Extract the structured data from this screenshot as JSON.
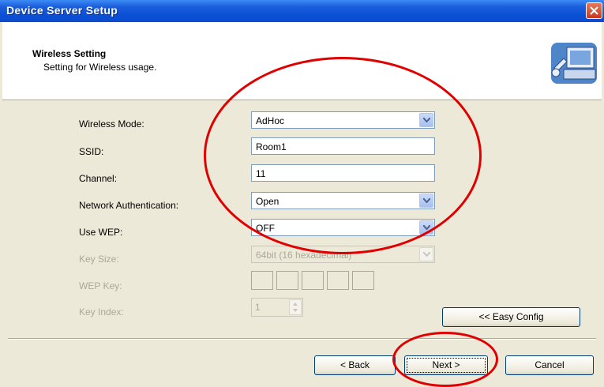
{
  "window": {
    "title": "Device Server Setup"
  },
  "header": {
    "title": "Wireless Setting",
    "subtitle": "Setting for Wireless usage."
  },
  "form": {
    "wireless_mode": {
      "label": "Wireless Mode:",
      "value": "AdHoc"
    },
    "ssid": {
      "label": "SSID:",
      "value": "Room1"
    },
    "channel": {
      "label": "Channel:",
      "value": "11"
    },
    "network_auth": {
      "label": "Network Authentication:",
      "value": "Open"
    },
    "use_wep": {
      "label": "Use WEP:",
      "value": "OFF"
    },
    "key_size": {
      "label": "Key Size:",
      "value": "64bit (16 hexadecimal)",
      "enabled": false
    },
    "wep_key": {
      "label": "WEP Key:",
      "fields": [
        "",
        "",
        "",
        "",
        ""
      ],
      "enabled": false
    },
    "key_index": {
      "label": "Key Index:",
      "value": "1",
      "enabled": false
    }
  },
  "buttons": {
    "easy_config": "<< Easy Config",
    "back": "< Back",
    "next": "Next >",
    "cancel": "Cancel"
  },
  "annotations": {
    "color": "#e00000"
  },
  "colors": {
    "titlebar": "#0a4fd6",
    "dialog": "#ece9d8",
    "disabled_text": "#aca899"
  }
}
